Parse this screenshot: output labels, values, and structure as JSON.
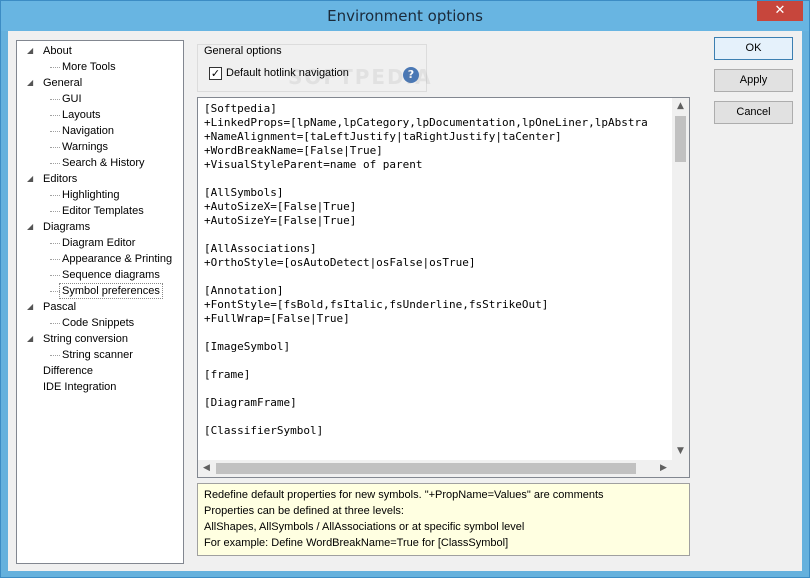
{
  "window": {
    "title": "Environment options",
    "close_glyph": "✕"
  },
  "tree": {
    "items": [
      {
        "label": "About",
        "level": 0,
        "expanded": true
      },
      {
        "label": "More Tools",
        "level": 1
      },
      {
        "label": "General",
        "level": 0,
        "expanded": true
      },
      {
        "label": "GUI",
        "level": 1
      },
      {
        "label": "Layouts",
        "level": 1
      },
      {
        "label": "Navigation",
        "level": 1
      },
      {
        "label": "Warnings",
        "level": 1
      },
      {
        "label": "Search & History",
        "level": 1
      },
      {
        "label": "Editors",
        "level": 0,
        "expanded": true
      },
      {
        "label": "Highlighting",
        "level": 1
      },
      {
        "label": "Editor Templates",
        "level": 1
      },
      {
        "label": "Diagrams",
        "level": 0,
        "expanded": true
      },
      {
        "label": "Diagram Editor",
        "level": 1
      },
      {
        "label": "Appearance & Printing",
        "level": 1
      },
      {
        "label": "Sequence diagrams",
        "level": 1
      },
      {
        "label": "Symbol preferences",
        "level": 1,
        "selected": true
      },
      {
        "label": "Pascal",
        "level": 0,
        "expanded": true
      },
      {
        "label": "Code Snippets",
        "level": 1
      },
      {
        "label": "String conversion",
        "level": 0,
        "expanded": true
      },
      {
        "label": "String scanner",
        "level": 1
      },
      {
        "label": "Difference",
        "level": 0
      },
      {
        "label": "IDE Integration",
        "level": 0
      }
    ]
  },
  "general_options": {
    "title": "General options",
    "checkbox_label": "Default hotlink navigation",
    "checkbox_checked": true,
    "check_glyph": "✓",
    "help_glyph": "?"
  },
  "editor": {
    "lines": [
      "[Softpedia]",
      "+LinkedProps=[lpName,lpCategory,lpDocumentation,lpOneLiner,lpAbstra",
      "+NameAlignment=[taLeftJustify|taRightJustify|taCenter]",
      "+WordBreakName=[False|True]",
      "+VisualStyleParent=name of parent",
      "",
      "[AllSymbols]",
      "+AutoSizeX=[False|True]",
      "+AutoSizeY=[False|True]",
      "",
      "[AllAssociations]",
      "+OrthoStyle=[osAutoDetect|osFalse|osTrue]",
      "",
      "[Annotation]",
      "+FontStyle=[fsBold,fsItalic,fsUnderline,fsStrikeOut]",
      "+FullWrap=[False|True]",
      "",
      "[ImageSymbol]",
      "",
      "[frame]",
      "",
      "[DiagramFrame]",
      "",
      "[ClassifierSymbol]"
    ],
    "scroll_up": "▲",
    "scroll_down": "▼",
    "scroll_left": "◀",
    "scroll_right": "▶"
  },
  "info": {
    "lines": [
      "Redefine default properties for new symbols. \"+PropName=Values\" are comments",
      "Properties can be defined at three levels:",
      "AllShapes, AllSymbols / AllAssociations or at specific symbol level",
      "For example: Define WordBreakName=True for [ClassSymbol]"
    ]
  },
  "buttons": {
    "ok": "OK",
    "apply": "Apply",
    "cancel": "Cancel"
  },
  "watermark": "SOFTPEDIA"
}
